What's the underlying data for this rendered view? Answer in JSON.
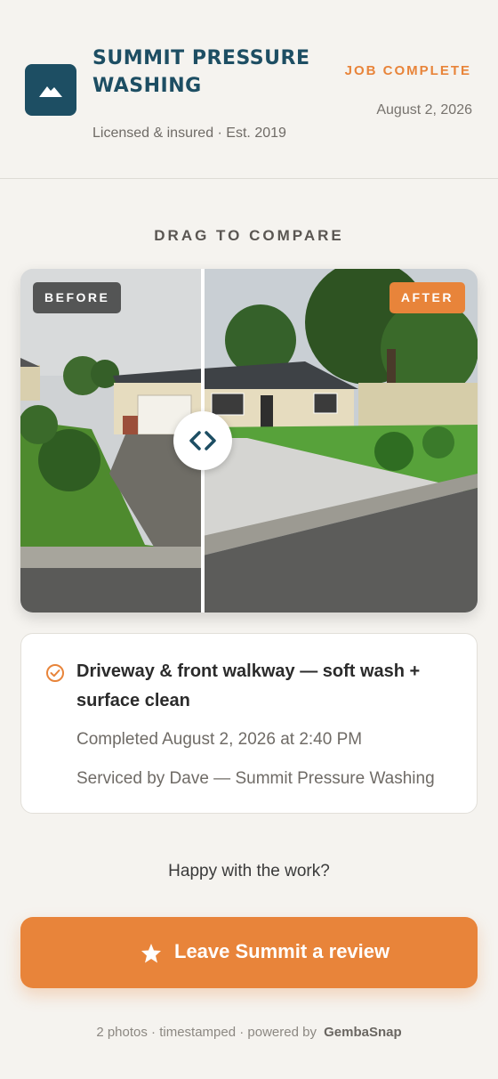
{
  "header": {
    "business_name": "SUMMIT PRESSURE WASHING",
    "tagline": "Licensed & insured · Est. 2019",
    "status": "JOB COMPLETE",
    "date": "August 2, 2026",
    "logo_icon": "mountain-icon",
    "brand_color": "#1d4e63",
    "accent_color": "#e8843a"
  },
  "compare": {
    "title": "DRAG TO COMPARE",
    "before_label": "BEFORE",
    "after_label": "AFTER",
    "handle_icon": "chevron-left-right-icon",
    "slider_position": 0.4
  },
  "job": {
    "icon": "check-circle-icon",
    "title": "Driveway & front walkway — soft wash + surface clean",
    "completed": "Completed August 2, 2026 at 2:40 PM",
    "serviced_by": "Serviced by Dave — Summit Pressure Washing"
  },
  "prompt": "Happy with the work?",
  "review_button": {
    "icon": "star-icon",
    "label": "Leave Summit a review"
  },
  "footer": {
    "text": "2 photos · timestamped · powered by",
    "brand": "GembaSnap"
  }
}
